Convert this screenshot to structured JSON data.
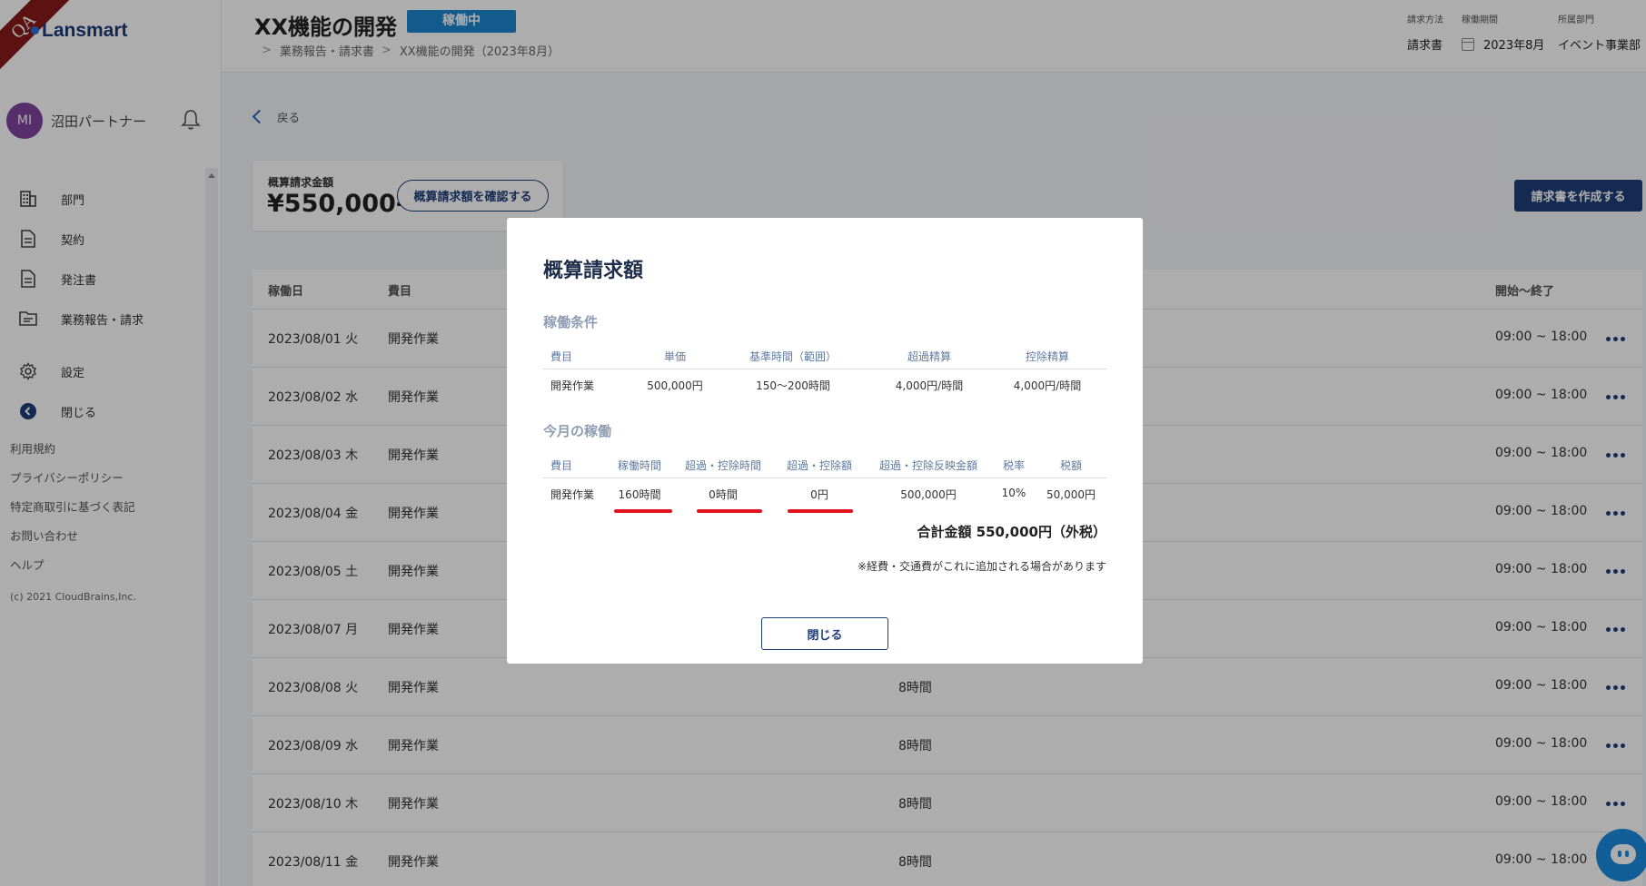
{
  "app": {
    "logo": "Lansmart",
    "env_ribbon": "QA"
  },
  "user": {
    "initials": "MI",
    "name": "沼田パートナー"
  },
  "sidebar": {
    "items": [
      {
        "label": "部門",
        "icon": "building-icon"
      },
      {
        "label": "契約",
        "icon": "document-icon"
      },
      {
        "label": "発注書",
        "icon": "document-icon"
      },
      {
        "label": "業務報告・請求",
        "icon": "folder-icon"
      },
      {
        "label": "設定",
        "icon": "gear-icon"
      },
      {
        "label": "閉じる",
        "icon": "collapse-icon"
      }
    ],
    "footer_links": [
      "利用規約",
      "プライバシーポリシー",
      "特定商取引に基づく表記",
      "お問い合わせ",
      "ヘルプ"
    ],
    "copyright": "(c) 2021 CloudBrains,Inc."
  },
  "header": {
    "title": "XX機能の開発",
    "status": "稼働中",
    "breadcrumb": [
      "業務報告・請求書",
      "XX機能の開発（2023年8月）"
    ],
    "meta": [
      {
        "label": "請求方法",
        "value": "請求書"
      },
      {
        "label": "稼働期間",
        "value": "2023年8月"
      },
      {
        "label": "所属部門",
        "value": "イベント事業部"
      }
    ]
  },
  "main": {
    "back_label": "戻る",
    "estimate": {
      "label": "概算請求金額",
      "amount": "¥550,000-",
      "confirm_button": "概算請求額を確認する"
    },
    "create_button": "請求書を作成する",
    "columns": {
      "date": "稼働日",
      "item": "費目",
      "time_range": "開始～終了"
    },
    "rows": [
      {
        "date": "2023/08/01 火",
        "item": "開発作業",
        "hours": "",
        "time": "09:00 ~ 18:00"
      },
      {
        "date": "2023/08/02 水",
        "item": "開発作業",
        "hours": "",
        "time": "09:00 ~ 18:00"
      },
      {
        "date": "2023/08/03 木",
        "item": "開発作業",
        "hours": "",
        "time": "09:00 ~ 18:00"
      },
      {
        "date": "2023/08/04 金",
        "item": "開発作業",
        "hours": "",
        "time": "09:00 ~ 18:00"
      },
      {
        "date": "2023/08/05 土",
        "item": "開発作業",
        "hours": "",
        "time": "09:00 ~ 18:00"
      },
      {
        "date": "2023/08/07 月",
        "item": "開発作業",
        "hours": "",
        "time": "09:00 ~ 18:00"
      },
      {
        "date": "2023/08/08 火",
        "item": "開発作業",
        "hours": "8時間",
        "time": "09:00 ~ 18:00"
      },
      {
        "date": "2023/08/09 水",
        "item": "開発作業",
        "hours": "8時間",
        "time": "09:00 ~ 18:00"
      },
      {
        "date": "2023/08/10 木",
        "item": "開発作業",
        "hours": "8時間",
        "time": "09:00 ~ 18:00"
      },
      {
        "date": "2023/08/11 金",
        "item": "開発作業",
        "hours": "8時間",
        "time": "09:00 ~ 18:00"
      }
    ]
  },
  "modal": {
    "title": "概算請求額",
    "conditions": {
      "title": "稼働条件",
      "headers": [
        "費目",
        "単価",
        "基準時間（範囲）",
        "超過精算",
        "控除精算"
      ],
      "row": [
        "開発作業",
        "500,000円",
        "150～200時間",
        "4,000円/時間",
        "4,000円/時間"
      ]
    },
    "monthly": {
      "title": "今月の稼働",
      "headers": [
        "費目",
        "稼働時間",
        "超過・控除時間",
        "超過・控除額",
        "超過・控除反映金額",
        "税率",
        "税額"
      ],
      "row": [
        "開発作業",
        "160時間",
        "0時間",
        "0円",
        "500,000円",
        "10%",
        "50,000円"
      ]
    },
    "total": "合計金額  550,000円（外税）",
    "note": "※経費・交通費がこれに追加される場合があります",
    "close_button": "閉じる"
  },
  "colors": {
    "brand": "#1f3f7a",
    "status_badge": "#1e86d0",
    "highlight_underline": "#e1141e",
    "avatar": "#7f44a0"
  }
}
